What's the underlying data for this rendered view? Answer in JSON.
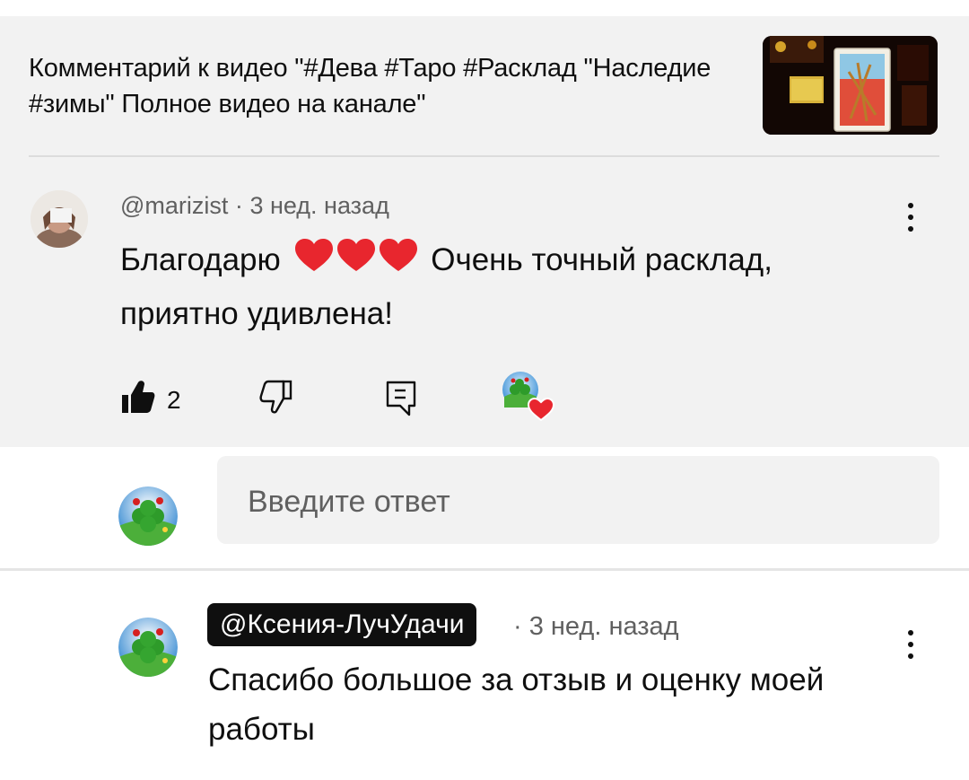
{
  "video": {
    "comment_header": "Комментарий к видео \"#Дева #Таро #Расклад \"Наследие #зимы\" Полное видео на канале\""
  },
  "comment": {
    "author": "@marizist",
    "separator": "·",
    "time": "3 нед. назад",
    "text_before": "Благодарю",
    "hearts": "❤️❤️❤️",
    "text_after": "Очень точный расклад, приятно удивлена!",
    "like_count": "2"
  },
  "reply_input": {
    "placeholder": "Введите ответ"
  },
  "reply": {
    "author": "@Ксения-ЛучУдачи",
    "meta": "· 3 нед. назад",
    "text": "Спасибо большое за отзыв и оценку моей работы"
  },
  "colors": {
    "panel_bg": "#f2f2f2",
    "text": "#0f0f0f",
    "secondary_text": "#606060",
    "heart": "#e8262e",
    "author_chip_bg": "#0f0f0f"
  },
  "icons": {
    "like": "thumbs-up-filled-icon",
    "dislike": "thumbs-down-outline-icon",
    "reply": "reply-comment-icon",
    "creator_heart": "creator-heart-icon",
    "menu": "kebab-menu-icon"
  }
}
